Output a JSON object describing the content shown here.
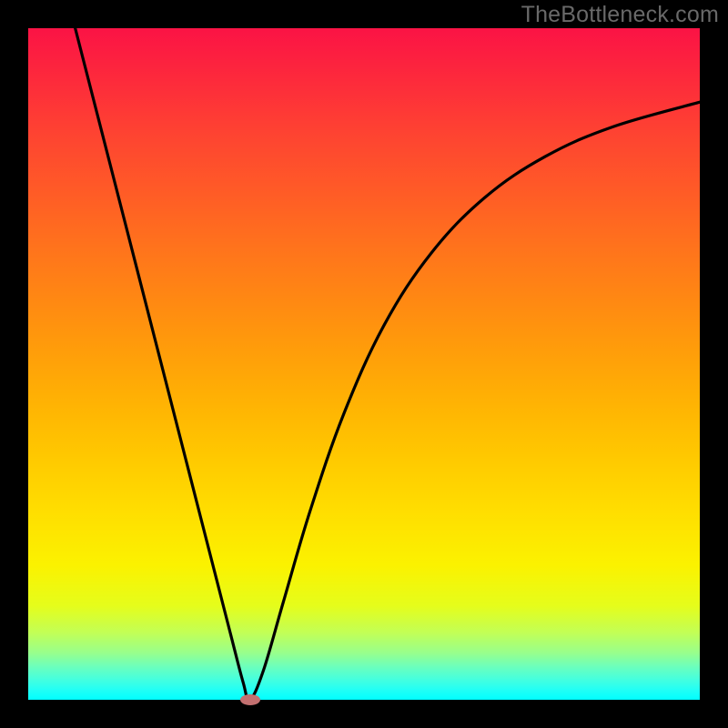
{
  "watermark": "TheBottleneck.com",
  "colors": {
    "frame": "#000000",
    "curve": "#000000",
    "marker": "#c37070",
    "watermark": "#696969"
  },
  "chart_data": {
    "type": "line",
    "title": "",
    "xlabel": "",
    "ylabel": "",
    "xlim": [
      0,
      100
    ],
    "ylim": [
      0,
      100
    ],
    "grid": false,
    "legend": false,
    "description": "V-shaped bottleneck curve on rainbow gradient background with minimum near x≈33; no axis ticks or numeric labels are rendered in the image.",
    "series": [
      {
        "name": "bottleneck-curve",
        "x": [
          7,
          10,
          14,
          18,
          22,
          26,
          30,
          32,
          33,
          35,
          38,
          42,
          47,
          53,
          60,
          68,
          77,
          87,
          100
        ],
        "y": [
          100,
          88.3,
          72.7,
          57.1,
          41.5,
          25.9,
          10.3,
          2.6,
          0,
          4.3,
          14.6,
          28.2,
          42.6,
          55.8,
          66.5,
          74.8,
          80.9,
          85.3,
          89.0
        ]
      }
    ],
    "annotations": [
      {
        "type": "marker",
        "shape": "ellipse",
        "x": 33,
        "y": 0,
        "color": "#c37070"
      }
    ],
    "background_gradient": {
      "direction": "vertical",
      "stops": [
        {
          "pos": 0.0,
          "color": "#fb1345"
        },
        {
          "pos": 0.5,
          "color": "#ffa006"
        },
        {
          "pos": 0.8,
          "color": "#fbf200"
        },
        {
          "pos": 1.0,
          "color": "#00ffff"
        }
      ]
    }
  }
}
